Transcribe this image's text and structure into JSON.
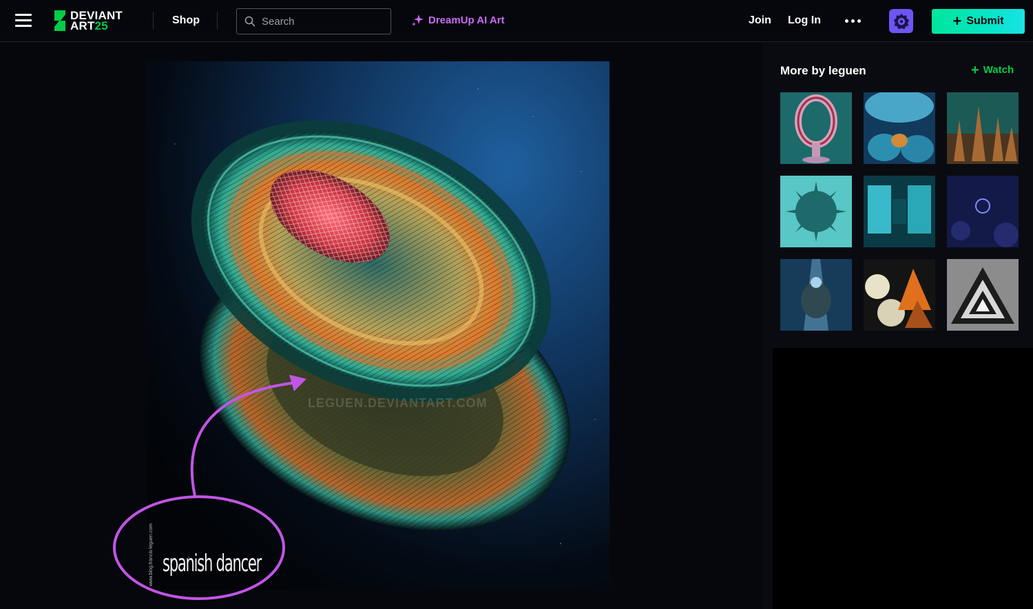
{
  "header": {
    "menu_icon": "hamburger-menu-icon",
    "logo": {
      "line1": "DEVIANT",
      "line2": "ART",
      "anniversary": "25"
    },
    "shop_label": "Shop",
    "search": {
      "placeholder": "Search",
      "value": ""
    },
    "dreamup_label": "DreamUp AI Art",
    "join_label": "Join",
    "login_label": "Log In",
    "more_icon": "ellipsis-icon",
    "core_icon": "core-membership-icon",
    "submit_label": "Submit"
  },
  "artwork": {
    "caption": "spanish dancer",
    "caption_url": "www.blog.francis-leguen.com",
    "watermark": "LEGUEN.DEVIANTART.COM"
  },
  "sidebar": {
    "title": "More by leguen",
    "watch_label": "Watch",
    "thumbnails": [
      {
        "subject": "teal-ring-sculpture"
      },
      {
        "subject": "blue-fractal-cavern"
      },
      {
        "subject": "copper-fractal-reef"
      },
      {
        "subject": "teal-spiked-sphere"
      },
      {
        "subject": "cyan-corridor"
      },
      {
        "subject": "purple-bubble-fractal"
      },
      {
        "subject": "blue-lit-fractal-tower"
      },
      {
        "subject": "spheres-and-pyramids"
      },
      {
        "subject": "triangle-tunnel"
      }
    ]
  },
  "colors": {
    "background": "#06070d",
    "sidebar": "#0a0b11",
    "brand_green": "#05cc47",
    "dreamup_purple": "#c96cf3",
    "core_purple": "#6c56f3",
    "annotation_magenta": "#c255e6",
    "submit_gradient_start": "#00e59b",
    "submit_gradient_end": "#19e2e6"
  }
}
